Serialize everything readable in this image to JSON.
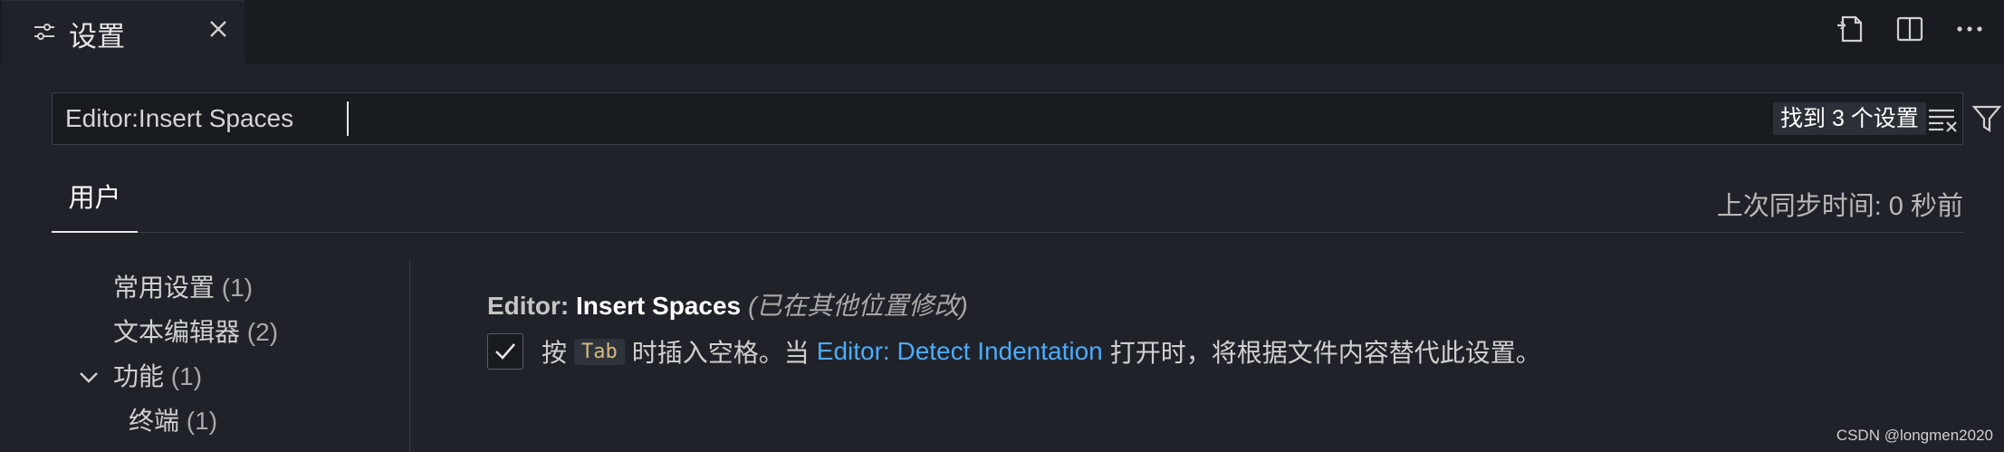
{
  "tab": {
    "label": "设置",
    "icon": "settings-sliders-icon",
    "close_icon": "close-icon"
  },
  "actions": [
    {
      "name": "open-settings-json-icon"
    },
    {
      "name": "split-editor-icon"
    },
    {
      "name": "more-actions-icon"
    }
  ],
  "search": {
    "value": "Editor:Insert Spaces",
    "result_count": "找到 3 个设置",
    "clear_icon": "clear-filter-icon",
    "filter_icon": "filter-icon"
  },
  "scope": {
    "active_tab": "用户",
    "sync_status": "上次同步时间: 0 秒前"
  },
  "toc": {
    "items": [
      {
        "label": "常用设置",
        "count": "(1)"
      },
      {
        "label": "文本编辑器",
        "count": "(2)"
      },
      {
        "label": "功能",
        "count": "(1)",
        "expanded": true
      },
      {
        "label": "终端",
        "count": "(1)"
      }
    ]
  },
  "setting": {
    "category": "Editor: ",
    "name": "Insert Spaces",
    "modified_note": "(已在其他位置修改)",
    "checked": true,
    "desc_before": "按",
    "desc_key": "Tab",
    "desc_middle": "时插入空格。当",
    "desc_link": "Editor: Detect Indentation",
    "desc_after": "打开时，将根据文件内容替代此设置。"
  },
  "watermark": "CSDN @longmen2020",
  "colors": {
    "background": "#1f2329",
    "tabbar": "#181b20",
    "link": "#4daafc",
    "key_text": "#d7ba7d"
  }
}
